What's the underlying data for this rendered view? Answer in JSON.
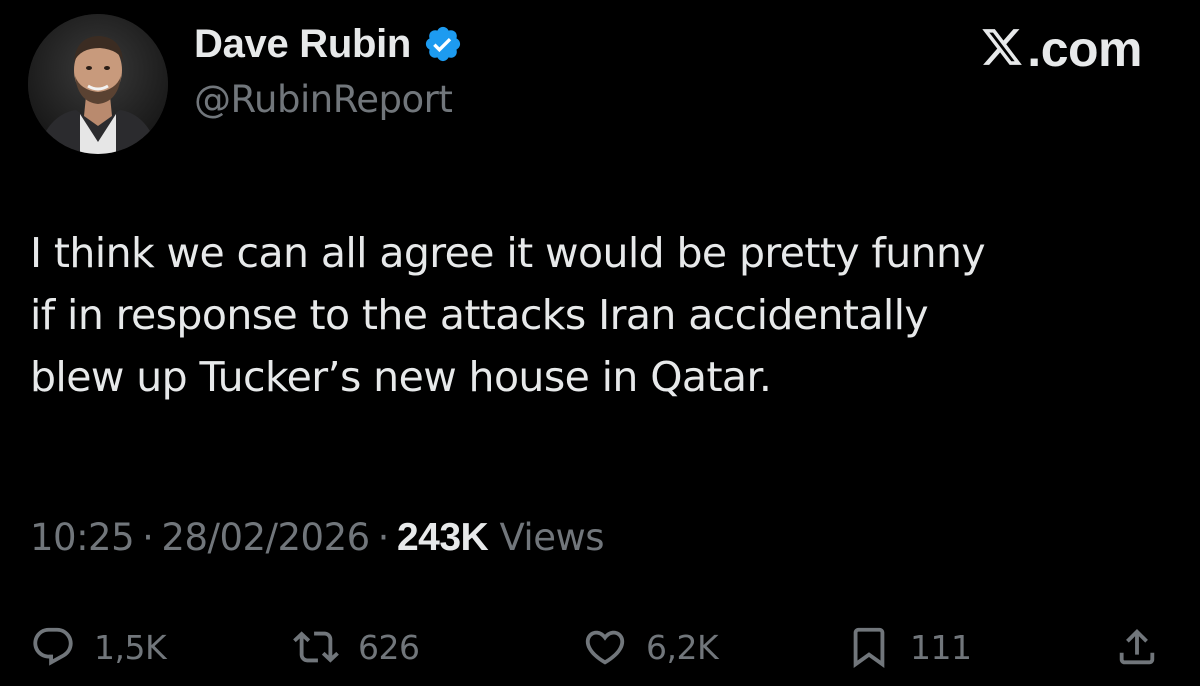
{
  "author": {
    "display_name": "Dave Rubin",
    "handle": "@RubinReport",
    "verified": true,
    "avatar_icon": "profile-photo",
    "verified_color": "#1d9bf0"
  },
  "brand": {
    "text": ".com",
    "logo_icon": "x-logo-icon"
  },
  "tweet": {
    "lines": [
      "I think we can all agree it would be pretty funny",
      "if in response to the attacks Iran accidentally",
      "blew up Tucker’s new house in Qatar."
    ]
  },
  "meta": {
    "time": "10:25",
    "separator": "·",
    "date": "28/02/2026",
    "views_count": "243K",
    "views_label": "Views"
  },
  "actions": {
    "replies": "1,5K",
    "reposts": "626",
    "likes": "6,2K",
    "bookmarks": "111"
  },
  "colors": {
    "background": "#000000",
    "text_primary": "#e7e9ea",
    "text_secondary": "#71767b"
  }
}
